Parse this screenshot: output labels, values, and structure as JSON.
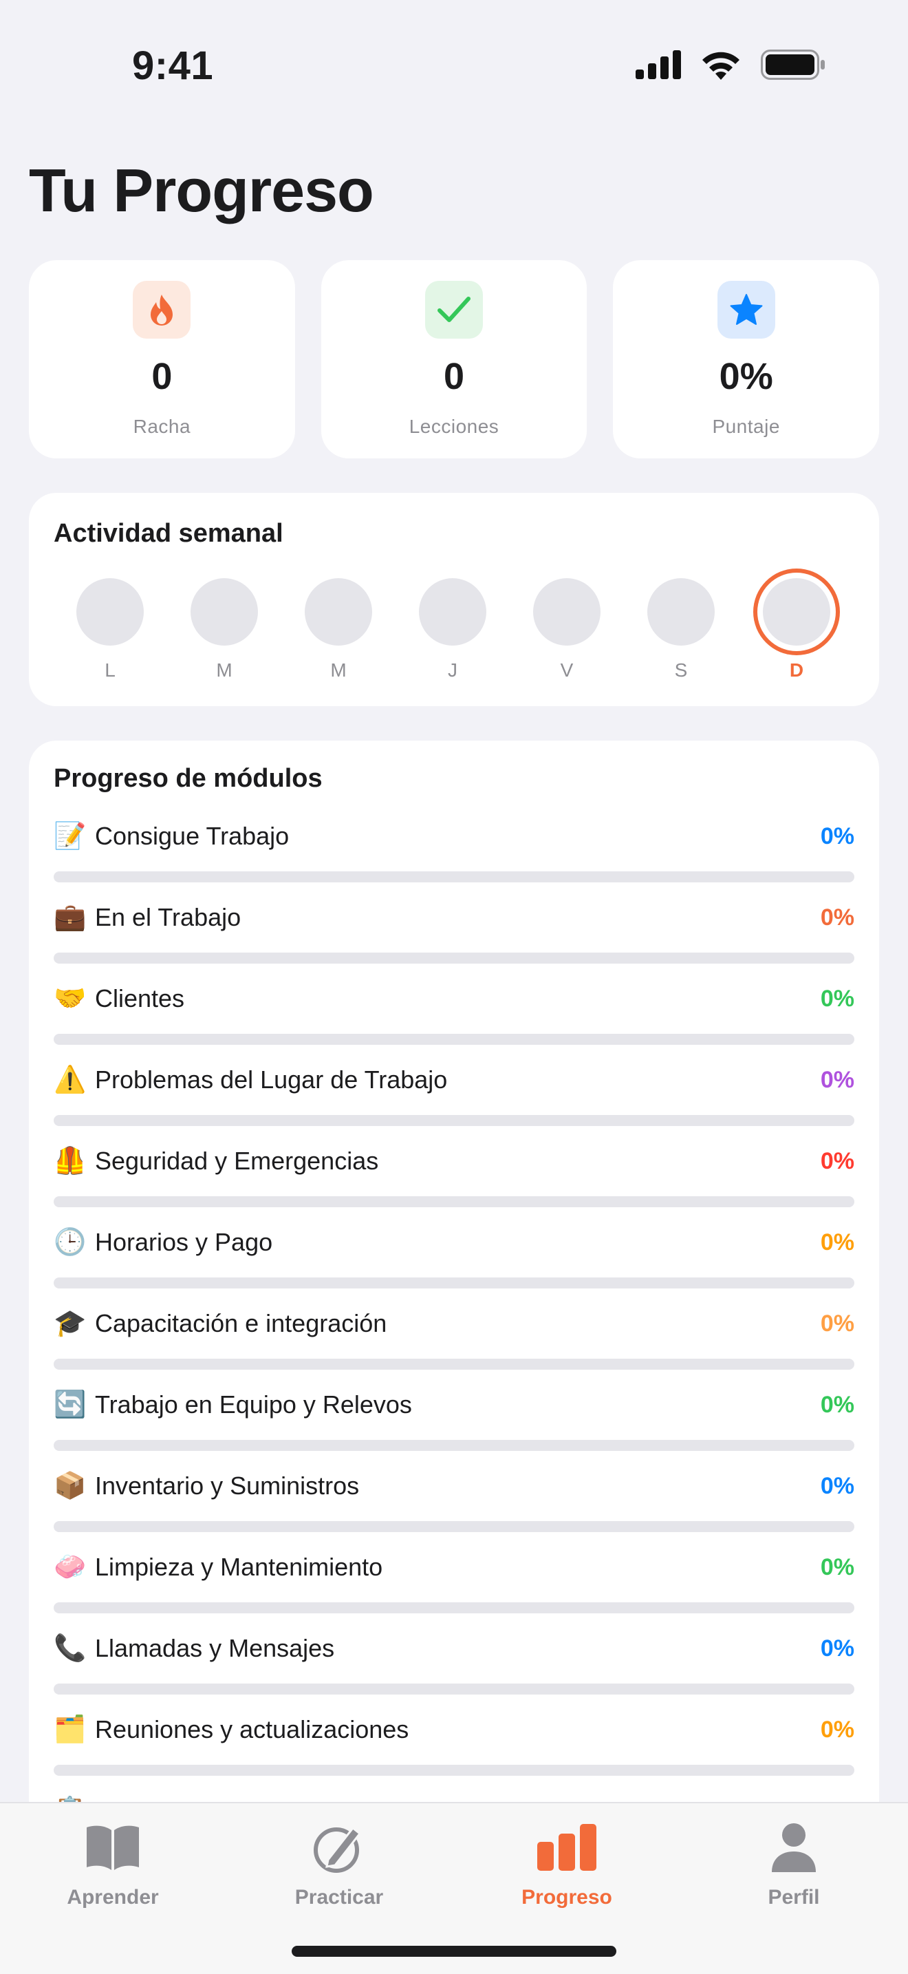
{
  "status_bar": {
    "time": "9:41"
  },
  "page": {
    "title": "Tu Progreso"
  },
  "stats": [
    {
      "icon": "flame-icon",
      "value": "0",
      "label": "Racha",
      "color": "#f26b3a",
      "bg": "#fde9df"
    },
    {
      "icon": "checkmark-icon",
      "value": "0",
      "label": "Lecciones",
      "color": "#34c759",
      "bg": "#e3f6e6"
    },
    {
      "icon": "star-icon",
      "value": "0%",
      "label": "Puntaje",
      "color": "#0a84ff",
      "bg": "#dceafd"
    }
  ],
  "weekly": {
    "title": "Actividad semanal",
    "days": [
      "L",
      "M",
      "M",
      "J",
      "V",
      "S",
      "D"
    ],
    "today_index": 6
  },
  "modules": {
    "title": "Progreso de módulos",
    "items": [
      {
        "emoji": "📝",
        "name": "Consigue Trabajo",
        "percent": "0%",
        "progress": 0,
        "color": "#0a84ff"
      },
      {
        "emoji": "💼",
        "name": "En el Trabajo",
        "percent": "0%",
        "progress": 0,
        "color": "#f26b3a"
      },
      {
        "emoji": "🤝",
        "name": "Clientes",
        "percent": "0%",
        "progress": 0,
        "color": "#34c759"
      },
      {
        "emoji": "⚠️",
        "name": "Problemas del Lugar de Trabajo",
        "percent": "0%",
        "progress": 0,
        "color": "#af52de"
      },
      {
        "emoji": "🦺",
        "name": "Seguridad y Emergencias",
        "percent": "0%",
        "progress": 0,
        "color": "#ff3b30"
      },
      {
        "emoji": "🕒",
        "name": "Horarios y Pago",
        "percent": "0%",
        "progress": 0,
        "color": "#ff9f0a"
      },
      {
        "emoji": "🎓",
        "name": "Capacitación e integración",
        "percent": "0%",
        "progress": 0,
        "color": "#ff9f43"
      },
      {
        "emoji": "🔄",
        "name": "Trabajo en Equipo y Relevos",
        "percent": "0%",
        "progress": 0,
        "color": "#34c759"
      },
      {
        "emoji": "📦",
        "name": "Inventario y Suministros",
        "percent": "0%",
        "progress": 0,
        "color": "#0a84ff"
      },
      {
        "emoji": "🧼",
        "name": "Limpieza y Mantenimiento",
        "percent": "0%",
        "progress": 0,
        "color": "#34c759"
      },
      {
        "emoji": "📞",
        "name": "Llamadas y Mensajes",
        "percent": "0%",
        "progress": 0,
        "color": "#0a84ff"
      },
      {
        "emoji": "🗂️",
        "name": "Reuniones y actualizaciones",
        "percent": "0%",
        "progress": 0,
        "color": "#ff9f0a"
      },
      {
        "emoji": "📋",
        "name": "",
        "percent": "",
        "progress": 0,
        "color": "#8e8e93"
      }
    ]
  },
  "tabs": [
    {
      "label": "Aprender",
      "icon": "book-icon",
      "active": false
    },
    {
      "label": "Practicar",
      "icon": "compass-pencil-icon",
      "active": false
    },
    {
      "label": "Progreso",
      "icon": "bar-chart-icon",
      "active": true
    },
    {
      "label": "Perfil",
      "icon": "person-icon",
      "active": false
    }
  ],
  "colors": {
    "accent": "#f26b3a",
    "inactive": "#8e8e93",
    "track": "#e5e5ea"
  }
}
